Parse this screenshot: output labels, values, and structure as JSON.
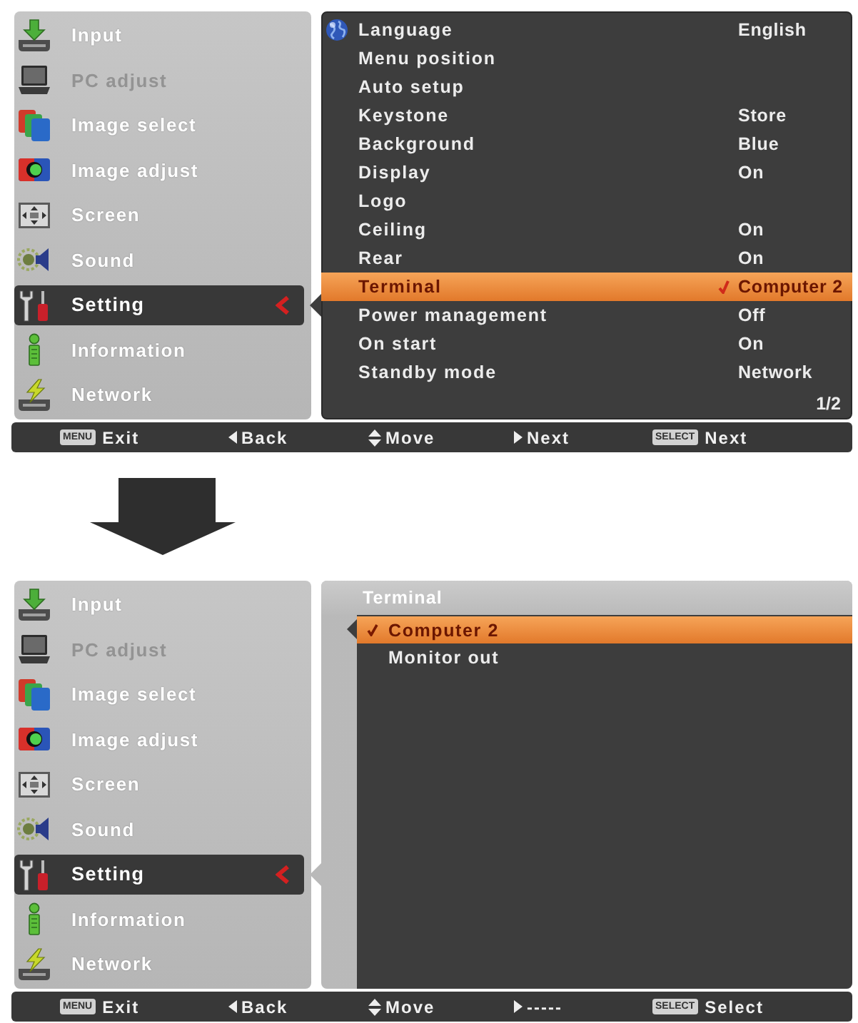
{
  "screens": [
    {
      "sidebar": {
        "items": [
          {
            "label": "Input",
            "selected": false,
            "disabled": false
          },
          {
            "label": "PC adjust",
            "selected": false,
            "disabled": true
          },
          {
            "label": "Image select",
            "selected": false,
            "disabled": false
          },
          {
            "label": "Image adjust",
            "selected": false,
            "disabled": false
          },
          {
            "label": "Screen",
            "selected": false,
            "disabled": false
          },
          {
            "label": "Sound",
            "selected": false,
            "disabled": false
          },
          {
            "label": "Setting",
            "selected": true,
            "disabled": false
          },
          {
            "label": "Information",
            "selected": false,
            "disabled": false
          },
          {
            "label": "Network",
            "selected": false,
            "disabled": false
          }
        ]
      },
      "panel": {
        "kind": "list",
        "rows": [
          {
            "label": "Language",
            "value": "English",
            "selected": false
          },
          {
            "label": "Menu position",
            "selected": false
          },
          {
            "label": "Auto setup",
            "selected": false
          },
          {
            "label": "Keystone",
            "value": "Store",
            "selected": false
          },
          {
            "label": "Background",
            "value": "Blue",
            "selected": false
          },
          {
            "label": "Display",
            "value": "On",
            "selected": false
          },
          {
            "label": "Logo",
            "selected": false
          },
          {
            "label": "Ceiling",
            "value": "On",
            "selected": false
          },
          {
            "label": "Rear",
            "value": "On",
            "selected": false
          },
          {
            "label": "Terminal",
            "value": "Computer 2",
            "selected": true
          },
          {
            "label": "Power management",
            "value": "Off",
            "selected": false
          },
          {
            "label": "On start",
            "value": "On",
            "selected": false
          },
          {
            "label": "Standby mode",
            "value": "Network",
            "selected": false
          }
        ],
        "page": "1/2"
      },
      "status_bar": [
        {
          "kind": "key",
          "key": "MENU",
          "label": "Exit"
        },
        {
          "kind": "left",
          "label": "Back"
        },
        {
          "kind": "updown",
          "label": "Move"
        },
        {
          "kind": "right",
          "label": "Next"
        },
        {
          "kind": "key",
          "key": "SELECT",
          "label": "Next"
        }
      ]
    },
    {
      "sidebar": {
        "items": [
          {
            "label": "Input",
            "selected": false,
            "disabled": false
          },
          {
            "label": "PC adjust",
            "selected": false,
            "disabled": true
          },
          {
            "label": "Image select",
            "selected": false,
            "disabled": false
          },
          {
            "label": "Image adjust",
            "selected": false,
            "disabled": false
          },
          {
            "label": "Screen",
            "selected": false,
            "disabled": false
          },
          {
            "label": "Sound",
            "selected": false,
            "disabled": false
          },
          {
            "label": "Setting",
            "selected": true,
            "disabled": false
          },
          {
            "label": "Information",
            "selected": false,
            "disabled": false
          },
          {
            "label": "Network",
            "selected": false,
            "disabled": false
          }
        ]
      },
      "panel": {
        "kind": "submenu",
        "title": "Terminal",
        "options": [
          {
            "label": "Computer 2",
            "checked": true,
            "selected": true
          },
          {
            "label": "Monitor out",
            "checked": false,
            "selected": false
          }
        ]
      },
      "status_bar": [
        {
          "kind": "key",
          "key": "MENU",
          "label": "Exit"
        },
        {
          "kind": "left",
          "label": "Back"
        },
        {
          "kind": "updown",
          "label": "Move"
        },
        {
          "kind": "right",
          "label": "-----"
        },
        {
          "kind": "key",
          "key": "SELECT",
          "label": "Select"
        }
      ]
    }
  ]
}
